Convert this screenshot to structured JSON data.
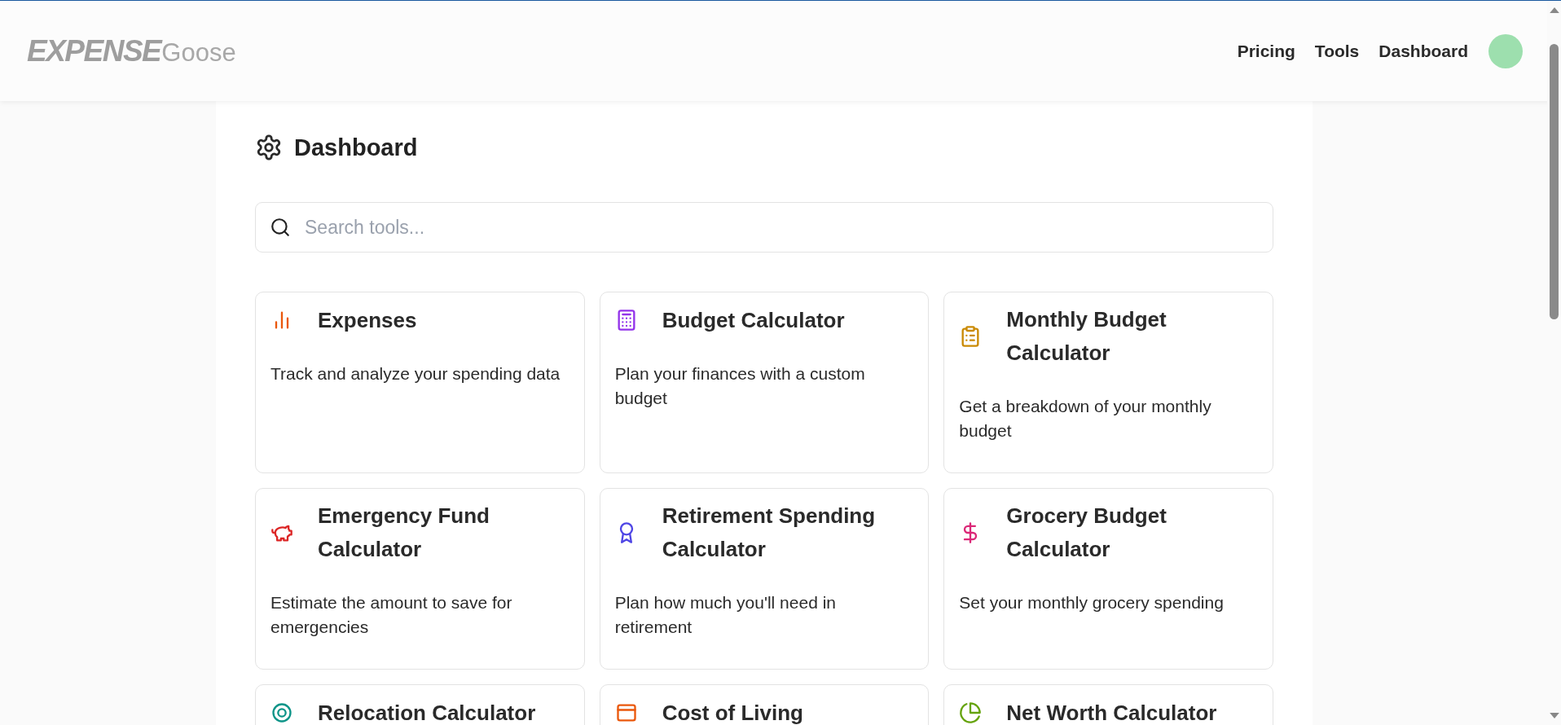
{
  "header": {
    "logo_bold": "EXPENSE",
    "logo_light": "Goose",
    "nav": [
      {
        "label": "Pricing"
      },
      {
        "label": "Tools"
      },
      {
        "label": "Dashboard"
      }
    ]
  },
  "page": {
    "title": "Dashboard",
    "search": {
      "placeholder": "Search tools..."
    }
  },
  "tools": [
    {
      "kind": "bars",
      "color": "#ea580c",
      "title": "Expenses",
      "description": "Track and analyze your spending data"
    },
    {
      "kind": "calculator",
      "color": "#9333ea",
      "title": "Budget Calculator",
      "description": "Plan your finances with a custom budget"
    },
    {
      "kind": "clipboard",
      "color": "#ca8a04",
      "title": "Monthly Budget Calculator",
      "description": "Get a breakdown of your monthly budget"
    },
    {
      "kind": "piggy",
      "color": "#dc2626",
      "title": "Emergency Fund Calculator",
      "description": "Estimate the amount to save for emergencies"
    },
    {
      "kind": "award",
      "color": "#4f46e5",
      "title": "Retirement Spending Calculator",
      "description": "Plan how much you'll need in retirement"
    },
    {
      "kind": "dollar",
      "color": "#db2777",
      "title": "Grocery Budget Calculator",
      "description": "Set your monthly grocery spending"
    },
    {
      "kind": "target",
      "color": "#0d9488",
      "title": "Relocation Calculator"
    },
    {
      "kind": "box",
      "color": "#ea580c",
      "title": "Cost of Living"
    },
    {
      "kind": "pie",
      "color": "#65a30d",
      "title": "Net Worth Calculator"
    }
  ]
}
